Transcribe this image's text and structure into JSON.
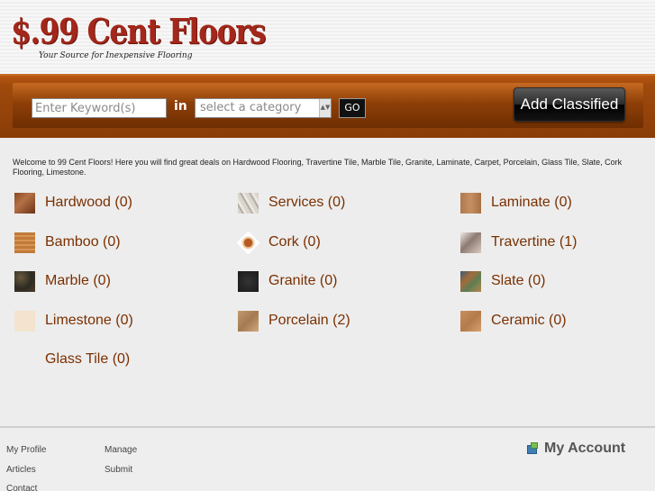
{
  "header": {
    "logo_title": "$.99 Cent Floors",
    "logo_tagline": "Your Source for Inexpensive Flooring"
  },
  "search": {
    "keyword_placeholder": "Enter Keyword(s)",
    "in_label": "in",
    "category_placeholder": "select a category",
    "go_label": "GO",
    "add_classified_label": "Add Classified"
  },
  "welcome_text": "Welcome to 99 Cent Floors! Here you will find great deals on Hardwood Flooring, Travertine Tile, Marble Tile, Granite, Laminate, Carpet, Porcelain, Glass Tile, Slate, Cork Flooring, Limestone.",
  "categories": [
    {
      "label": "Hardwood (0)",
      "icon": "hardwood-thumbnail-icon"
    },
    {
      "label": "Services (0)",
      "icon": "services-thumbnail-icon"
    },
    {
      "label": "Laminate (0)",
      "icon": "laminate-thumbnail-icon"
    },
    {
      "label": "Bamboo (0)",
      "icon": "bamboo-thumbnail-icon"
    },
    {
      "label": "Cork (0)",
      "icon": "cork-thumbnail-icon"
    },
    {
      "label": "Travertine (1)",
      "icon": "travertine-thumbnail-icon"
    },
    {
      "label": "Marble (0)",
      "icon": "marble-thumbnail-icon"
    },
    {
      "label": "Granite (0)",
      "icon": "granite-thumbnail-icon"
    },
    {
      "label": "Slate (0)",
      "icon": "slate-thumbnail-icon"
    },
    {
      "label": "Limestone (0)",
      "icon": "limestone-thumbnail-icon"
    },
    {
      "label": "Porcelain (2)",
      "icon": "porcelain-thumbnail-icon"
    },
    {
      "label": "Ceramic (0)",
      "icon": "ceramic-thumbnail-icon"
    },
    {
      "label": "Glass Tile (0)",
      "icon": ""
    }
  ],
  "footer": {
    "links": [
      "My Profile",
      "Manage",
      "Articles",
      "Submit",
      "Contact"
    ],
    "my_account_label": "My Account",
    "my_account_icon": "account-icon"
  },
  "colors": {
    "brand_red": "#a3271a",
    "bar_orange": "#8a3d07",
    "link_brown": "#7a3000"
  }
}
